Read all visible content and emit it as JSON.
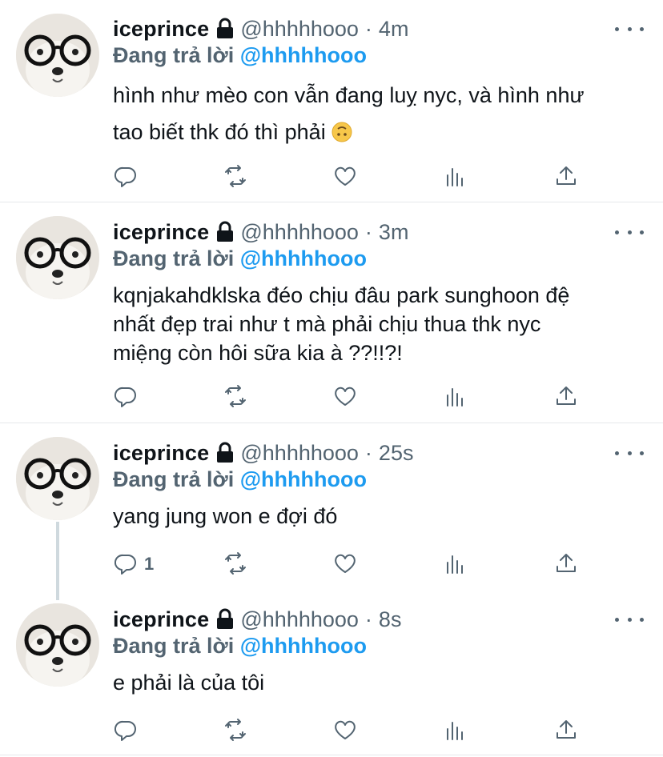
{
  "tweets": [
    {
      "name": "iceprince",
      "handle": "@hhhhhooo",
      "dot": "·",
      "time": "4m",
      "reply_prefix": "Đang trả lời",
      "reply_to": "@hhhhhooo",
      "text_lines": [
        "hình như mèo con vẫn đang luỵ nyc, và hình như",
        "tao biết thk đó thì phải"
      ],
      "emoji": "upside-down-face",
      "reply_count": ""
    },
    {
      "name": "iceprince",
      "handle": "@hhhhhooo",
      "dot": "·",
      "time": "3m",
      "reply_prefix": "Đang trả lời",
      "reply_to": "@hhhhhooo",
      "text_lines": [
        "kqnjakahdklska đéo chịu đâu park sunghoon đệ",
        "nhất đẹp trai như t mà phải chịu thua thk nyc",
        "miệng còn hôi sữa kia à ??!!?!"
      ],
      "reply_count": ""
    },
    {
      "name": "iceprince",
      "handle": "@hhhhhooo",
      "dot": "·",
      "time": "25s",
      "reply_prefix": "Đang trả lời",
      "reply_to": "@hhhhhooo",
      "text_lines": [
        "yang jung won e đợi đó"
      ],
      "reply_count": "1"
    },
    {
      "name": "iceprince",
      "handle": "@hhhhhooo",
      "dot": "·",
      "time": "8s",
      "reply_prefix": "Đang trả lời",
      "reply_to": "@hhhhhooo",
      "text_lines": [
        "e phải là của tôi"
      ],
      "reply_count": ""
    }
  ],
  "icons": {
    "account": "lock-icon",
    "reply": "reply-icon",
    "retweet": "retweet-icon",
    "like": "heart-icon",
    "analytics": "analytics-icon",
    "share": "share-icon",
    "more": "more-icon"
  },
  "colors": {
    "text": "#0f1419",
    "secondary": "#536471",
    "mention": "#1d9bf0",
    "divider": "#e6e8eb"
  }
}
